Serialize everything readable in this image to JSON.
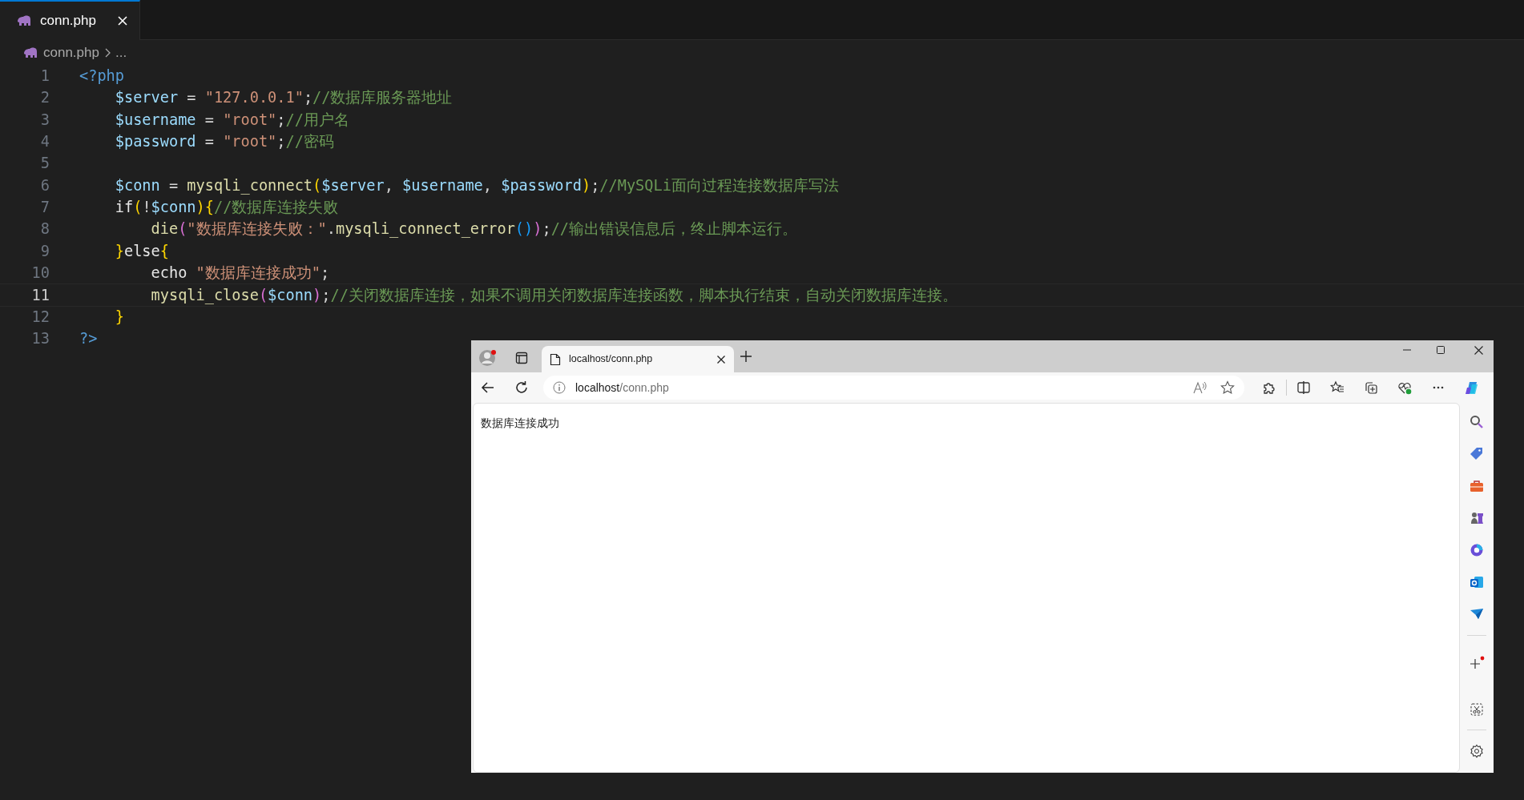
{
  "editor": {
    "tabs": [
      {
        "label": "conn.php",
        "selected": true
      }
    ],
    "breadcrumb": {
      "file": "conn.php",
      "rest": "..."
    },
    "lines": [
      {
        "number": "1",
        "current": false,
        "tokens": [
          {
            "kind": "tag",
            "text": "<?php"
          }
        ]
      },
      {
        "number": "2",
        "current": false,
        "tokens": [
          {
            "kind": "variable",
            "text": "    $server"
          },
          {
            "kind": "operator",
            "text": " = "
          },
          {
            "kind": "string",
            "text": "\"127.0.0.1\""
          },
          {
            "kind": "operator",
            "text": ";"
          },
          {
            "kind": "comment",
            "text": "//数据库服务器地址"
          }
        ]
      },
      {
        "number": "3",
        "current": false,
        "tokens": [
          {
            "kind": "variable",
            "text": "    $username"
          },
          {
            "kind": "operator",
            "text": " = "
          },
          {
            "kind": "string",
            "text": "\"root\""
          },
          {
            "kind": "operator",
            "text": ";"
          },
          {
            "kind": "comment",
            "text": "//用户名"
          }
        ]
      },
      {
        "number": "4",
        "current": false,
        "tokens": [
          {
            "kind": "variable",
            "text": "    $password"
          },
          {
            "kind": "operator",
            "text": " = "
          },
          {
            "kind": "string",
            "text": "\"root\""
          },
          {
            "kind": "operator",
            "text": ";"
          },
          {
            "kind": "comment",
            "text": "//密码"
          }
        ]
      },
      {
        "number": "5",
        "current": false
      },
      {
        "number": "6",
        "current": false,
        "tokens": [
          {
            "kind": "variable",
            "text": "    $conn"
          },
          {
            "kind": "operator",
            "text": " = "
          },
          {
            "kind": "function",
            "text": "mysqli_connect"
          },
          {
            "kind": "bracket1",
            "text": "("
          },
          {
            "kind": "variable",
            "text": "$server"
          },
          {
            "kind": "operator",
            "text": ", "
          },
          {
            "kind": "variable",
            "text": "$username"
          },
          {
            "kind": "operator",
            "text": ", "
          },
          {
            "kind": "variable",
            "text": "$password"
          },
          {
            "kind": "bracket1",
            "text": ")"
          },
          {
            "kind": "operator",
            "text": ";"
          },
          {
            "kind": "comment",
            "text": "//MySQLi面向过程连接数据库写法"
          }
        ]
      },
      {
        "number": "7",
        "current": false,
        "tokens": [
          {
            "kind": "keyword",
            "text": "    if"
          },
          {
            "kind": "bracket1",
            "text": "("
          },
          {
            "kind": "operator",
            "text": "!"
          },
          {
            "kind": "variable",
            "text": "$conn"
          },
          {
            "kind": "bracket1",
            "text": "){"
          },
          {
            "kind": "comment",
            "text": "//数据库连接失败"
          }
        ]
      },
      {
        "number": "8",
        "current": false,
        "tokens": [
          {
            "kind": "function",
            "text": "        die"
          },
          {
            "kind": "bracket2",
            "text": "("
          },
          {
            "kind": "string",
            "text": "\"数据库连接失败：\""
          },
          {
            "kind": "operator",
            "text": "."
          },
          {
            "kind": "function",
            "text": "mysqli_connect_error"
          },
          {
            "kind": "bracket3",
            "text": "()"
          },
          {
            "kind": "bracket2",
            "text": ")"
          },
          {
            "kind": "operator",
            "text": ";"
          },
          {
            "kind": "comment",
            "text": "//输出错误信息后，终止脚本运行。"
          }
        ]
      },
      {
        "number": "9",
        "current": false,
        "tokens": [
          {
            "kind": "bracket1",
            "text": "    }"
          },
          {
            "kind": "keyword",
            "text": "else"
          },
          {
            "kind": "bracket1",
            "text": "{"
          }
        ]
      },
      {
        "number": "10",
        "current": false,
        "tokens": [
          {
            "kind": "keyword",
            "text": "        echo "
          },
          {
            "kind": "string",
            "text": "\"数据库连接成功\""
          },
          {
            "kind": "operator",
            "text": ";"
          }
        ]
      },
      {
        "number": "11",
        "current": true,
        "tokens": [
          {
            "kind": "function",
            "text": "        mysqli_close"
          },
          {
            "kind": "bracket2",
            "text": "("
          },
          {
            "kind": "variable",
            "text": "$conn"
          },
          {
            "kind": "bracket2",
            "text": ")"
          },
          {
            "kind": "operator",
            "text": ";"
          },
          {
            "kind": "comment",
            "text": "//关闭数据库连接，如果不调用关闭数据库连接函数，脚本执行结束，自动关闭数据库连接。"
          }
        ]
      },
      {
        "number": "12",
        "current": false,
        "tokens": [
          {
            "kind": "bracket1",
            "text": "    }"
          }
        ]
      },
      {
        "number": "13",
        "current": false,
        "tokens": [
          {
            "kind": "tag",
            "text": "?>"
          }
        ]
      }
    ]
  },
  "browser": {
    "tabs": [
      {
        "label": "localhost/conn.php",
        "selected": true
      }
    ],
    "address": {
      "host": "localhost",
      "path": "/conn.php"
    },
    "page_text": "数据库连接成功"
  }
}
